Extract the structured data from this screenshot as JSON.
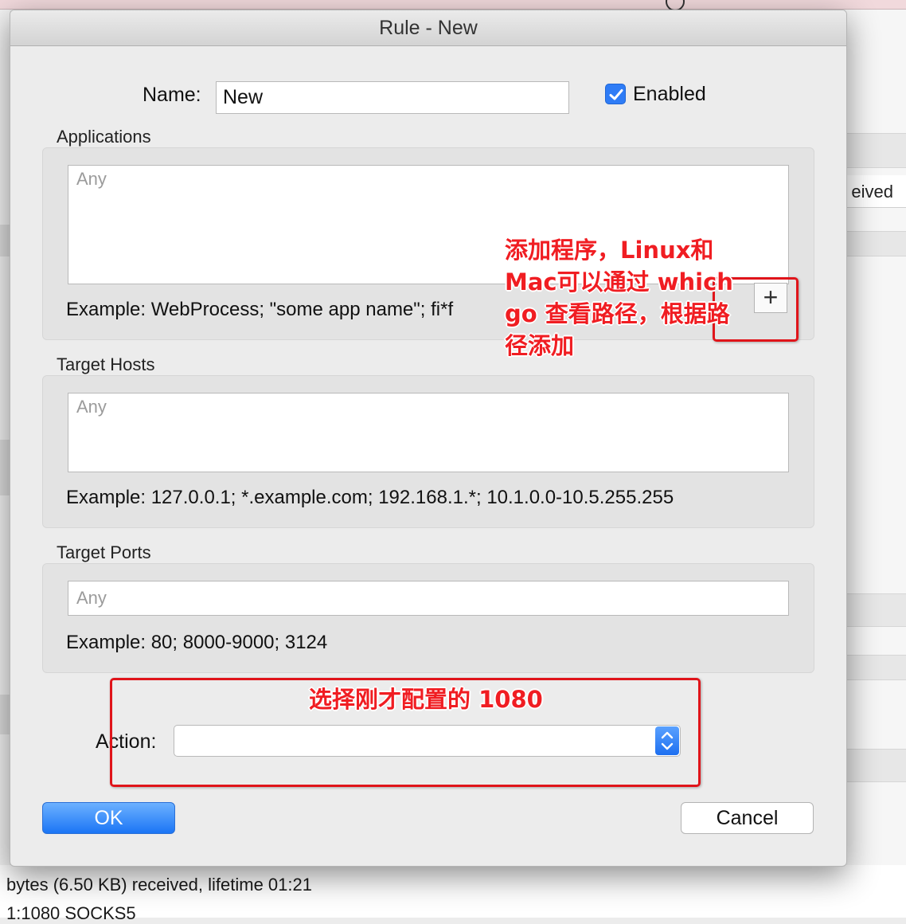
{
  "background": {
    "column_header_partial": "eived",
    "bottom_lines": [
      "bytes (6.50 KB) received, lifetime 01:21",
      "1:1080 SOCKS5"
    ]
  },
  "dialog": {
    "title": "Rule - New",
    "name": {
      "label": "Name:",
      "value": "New"
    },
    "enabled": {
      "label": "Enabled",
      "checked": true
    },
    "applications": {
      "label": "Applications",
      "placeholder": "Any",
      "example": "Example: WebProcess; \"some app name\"; fi*f",
      "add_button": "+"
    },
    "target_hosts": {
      "label": "Target Hosts",
      "placeholder": "Any",
      "example": "Example: 127.0.0.1; *.example.com; 192.168.1.*; 10.1.0.0-10.5.255.255"
    },
    "target_ports": {
      "label": "Target Ports",
      "placeholder": "Any",
      "example": "Example: 80; 8000-9000; 3124"
    },
    "action": {
      "label": "Action:",
      "value": ""
    },
    "buttons": {
      "ok": "OK",
      "cancel": "Cancel"
    }
  },
  "annotations": {
    "add_app_lines": [
      "添加程序，Linux和",
      "Mac可以通过 which",
      "go 查看路径，根据路",
      "径添加"
    ],
    "select_action": "选择刚才配置的 1080",
    "color": "#e0141a"
  }
}
